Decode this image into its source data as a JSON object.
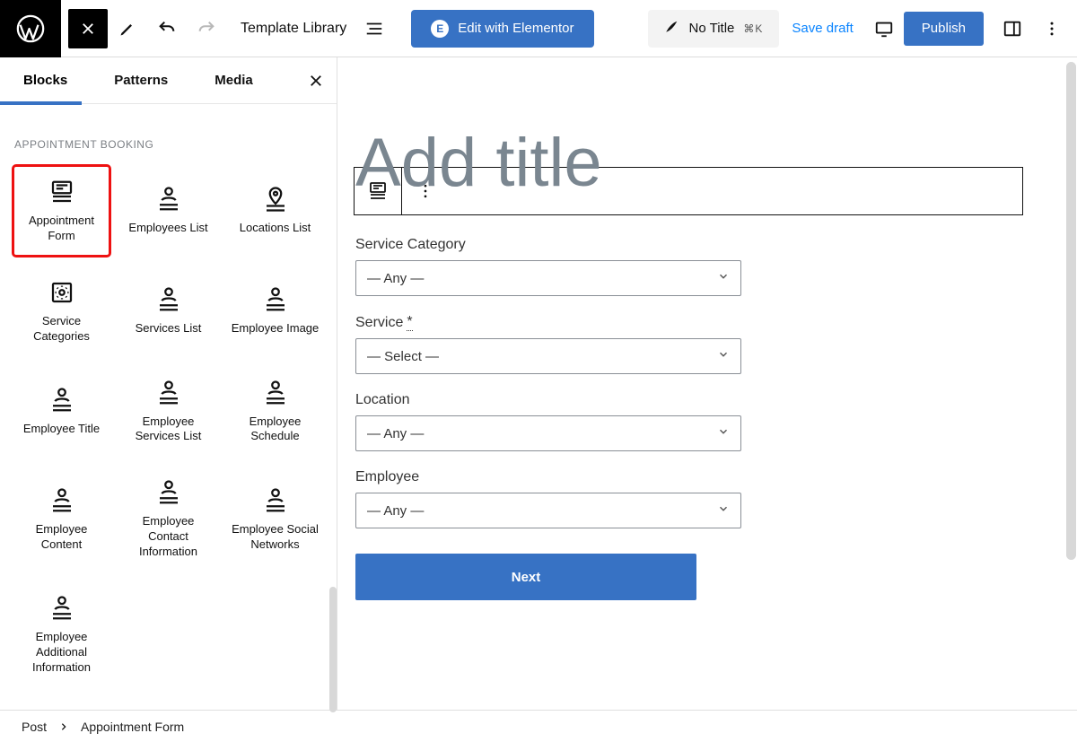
{
  "toolbar": {
    "template_library": "Template Library",
    "edit_elementor": "Edit with Elementor",
    "title": "No Title",
    "cmd_shortcut": "⌘K",
    "save_draft": "Save draft",
    "publish": "Publish"
  },
  "inserter": {
    "tabs": {
      "blocks": "Blocks",
      "patterns": "Patterns",
      "media": "Media"
    },
    "section": "APPOINTMENT BOOKING",
    "blocks": [
      {
        "label": "Appointment Form",
        "selected": true,
        "icon": "calendar-list"
      },
      {
        "label": "Employees List",
        "selected": false,
        "icon": "person-list"
      },
      {
        "label": "Locations List",
        "selected": false,
        "icon": "pin-list"
      },
      {
        "label": "Service Categories",
        "selected": false,
        "icon": "gear-box"
      },
      {
        "label": "Services List",
        "selected": false,
        "icon": "person-list"
      },
      {
        "label": "Employee Image",
        "selected": false,
        "icon": "person-list"
      },
      {
        "label": "Employee Title",
        "selected": false,
        "icon": "person-list"
      },
      {
        "label": "Employee Services List",
        "selected": false,
        "icon": "person-list"
      },
      {
        "label": "Employee Schedule",
        "selected": false,
        "icon": "person-list"
      },
      {
        "label": "Employee Content",
        "selected": false,
        "icon": "person-list"
      },
      {
        "label": "Employee Contact Information",
        "selected": false,
        "icon": "person-list"
      },
      {
        "label": "Employee Social Networks",
        "selected": false,
        "icon": "person-list"
      },
      {
        "label": "Employee Additional Information",
        "selected": false,
        "icon": "person-list"
      }
    ]
  },
  "canvas": {
    "title_placeholder": "Add title",
    "fields": [
      {
        "label": "Service Category",
        "value": "— Any —",
        "required": false
      },
      {
        "label": "Service",
        "value": "— Select —",
        "required": true
      },
      {
        "label": "Location",
        "value": "— Any —",
        "required": false
      },
      {
        "label": "Employee",
        "value": "— Any —",
        "required": false
      }
    ],
    "next": "Next"
  },
  "breadcrumb": {
    "root": "Post",
    "current": "Appointment Form"
  }
}
